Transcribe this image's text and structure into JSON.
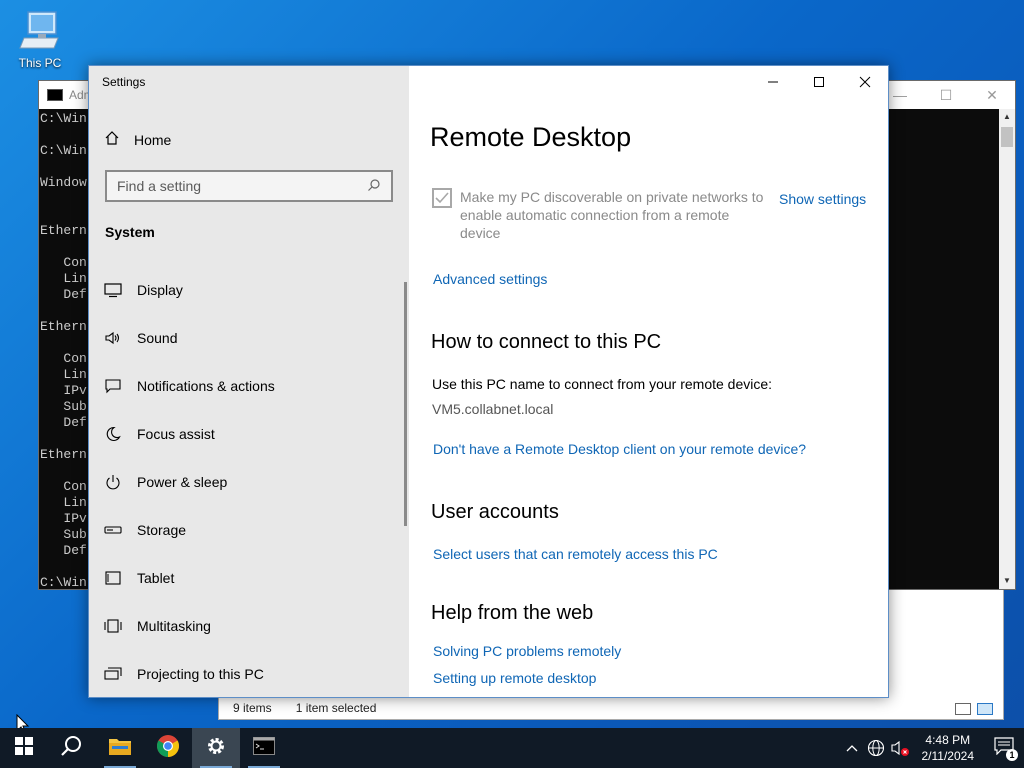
{
  "desktop": {
    "icon_label": "This PC"
  },
  "cmd": {
    "title": "Adm",
    "lines": [
      "C:\\Win",
      "",
      "C:\\Win",
      "",
      "Window",
      "",
      "",
      "Ethern",
      "",
      "   Con",
      "   Lin",
      "   Def",
      "",
      "Ethern",
      "",
      "   Con",
      "   Lin",
      "   IPv",
      "   Sub",
      "   Def",
      "",
      "Ethern",
      "",
      "   Con",
      "   Lin",
      "   IPv",
      "   Sub",
      "   Def",
      "",
      "C:\\Win"
    ]
  },
  "explorer": {
    "items_count": "9 items",
    "selected": "1 item selected"
  },
  "settings": {
    "window_title": "Settings",
    "home_label": "Home",
    "search_placeholder": "Find a setting",
    "section": "System",
    "nav": [
      {
        "label": "Display",
        "icon": "monitor-icon"
      },
      {
        "label": "Sound",
        "icon": "speaker-icon"
      },
      {
        "label": "Notifications & actions",
        "icon": "notification-icon"
      },
      {
        "label": "Focus assist",
        "icon": "moon-icon"
      },
      {
        "label": "Power & sleep",
        "icon": "power-icon"
      },
      {
        "label": "Storage",
        "icon": "storage-icon"
      },
      {
        "label": "Tablet",
        "icon": "tablet-icon"
      },
      {
        "label": "Multitasking",
        "icon": "multitasking-icon"
      },
      {
        "label": "Projecting to this PC",
        "icon": "projecting-icon"
      }
    ],
    "page_title": "Remote Desktop",
    "discoverable_text": "Make my PC discoverable on private networks to enable automatic connection from a remote device",
    "discoverable_checked": true,
    "show_settings": "Show settings",
    "advanced_settings": "Advanced settings",
    "how_to_heading": "How to connect to this PC",
    "use_pc_name": "Use this PC name to connect from your remote device:",
    "pc_name": "VM5.collabnet.local",
    "no_client_link": "Don't have a Remote Desktop client on your remote device?",
    "user_accounts_heading": "User accounts",
    "select_users_link": "Select users that can remotely access this PC",
    "help_heading": "Help from the web",
    "help_links": [
      "Solving PC problems remotely",
      "Setting up remote desktop"
    ]
  },
  "taskbar": {
    "time": "4:48 PM",
    "date": "2/11/2024",
    "notification_count": "1"
  }
}
